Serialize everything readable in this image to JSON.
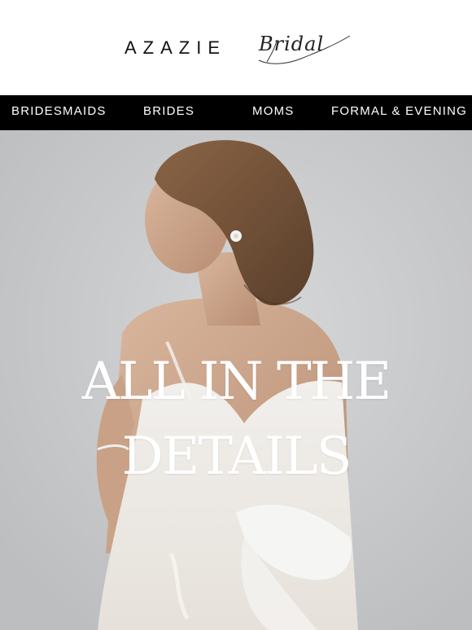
{
  "brand": {
    "name": "AZAZIE",
    "subline": "Bridal"
  },
  "nav": {
    "items": [
      "BRIDESMAIDS",
      "BRIDES",
      "MOMS",
      "FORMAL & EVENING"
    ]
  },
  "hero": {
    "title_line1": "ALL IN THE",
    "title_line2": "DETAILS"
  },
  "colors": {
    "nav_bg": "#000000",
    "nav_text": "#ffffff",
    "hero_bg": "#c9cacb",
    "hero_text": "#ffffff"
  }
}
